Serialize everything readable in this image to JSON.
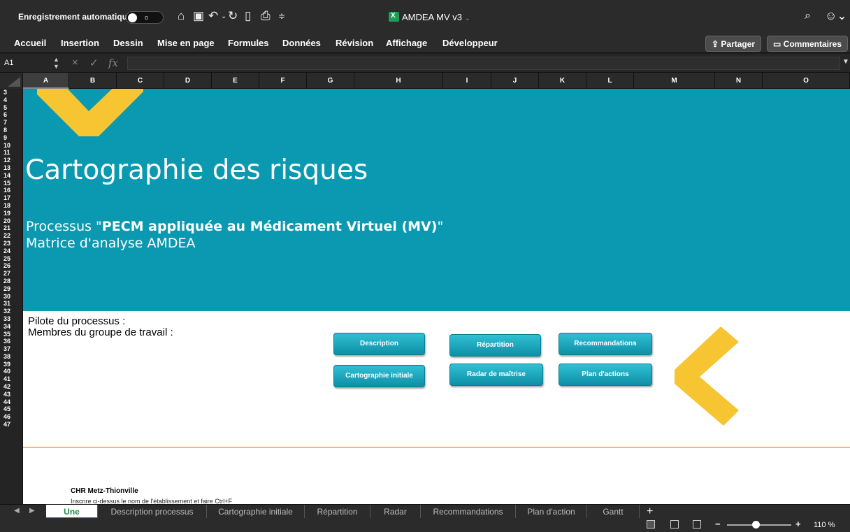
{
  "titlebar": {
    "autosave_label": "Enregistrement automatique",
    "autosave_state": "o",
    "doc_title": "AMDEA MV v3",
    "icons": [
      "home-icon",
      "save-icon",
      "undo-icon",
      "redo-icon",
      "new-doc-icon",
      "print-icon",
      "customize-icon",
      "search-icon",
      "emoji-icon"
    ]
  },
  "ribbon": {
    "tabs": [
      "Accueil",
      "Insertion",
      "Dessin",
      "Mise en page",
      "Formules",
      "Données",
      "Révision",
      "Affichage",
      "Développeur"
    ],
    "share_label": "Partager",
    "comments_label": "Commentaires"
  },
  "formula_bar": {
    "name_box": "A1",
    "fx_label": "fx",
    "value": ""
  },
  "columns": [
    "A",
    "B",
    "C",
    "D",
    "E",
    "F",
    "G",
    "H",
    "I",
    "J",
    "K",
    "L",
    "M",
    "N",
    "O"
  ],
  "rows": [
    "3",
    "4",
    "5",
    "6",
    "7",
    "8",
    "9",
    "10",
    "11",
    "12",
    "13",
    "14",
    "15",
    "16",
    "17",
    "18",
    "19",
    "20",
    "21",
    "22",
    "23",
    "24",
    "25",
    "26",
    "27",
    "28",
    "29",
    "30",
    "31",
    "32",
    "33",
    "34",
    "35",
    "36",
    "37",
    "38",
    "39",
    "40",
    "41",
    "42",
    "43",
    "44",
    "45",
    "46",
    "47"
  ],
  "sheet": {
    "title": "Cartographie des risques",
    "process_prefix": "Processus \"",
    "process_name": "PECM appliquée au Médicament Virtuel (MV)",
    "process_suffix": "\"",
    "matrix": "Matrice d'analyse AMDEA",
    "pilote": "Pilote du processus :",
    "members": "Membres du groupe de travail :",
    "buttons": {
      "description": "Description",
      "repartition": "Répartition",
      "recommandations": "Recommandations",
      "cartographie": "Cartographie initiale",
      "radar": "Radar de maîtrise",
      "plan": "Plan d'actions"
    },
    "org": "CHR Metz-Thionville",
    "hint": "Inscrire ci-dessus le nom de l'établissement et faire Ctrl+F"
  },
  "sheet_tabs": [
    "Une",
    "Description processus",
    "Cartographie initiale",
    "Répartition",
    "Radar",
    "Recommandations",
    "Plan d'action",
    "Gantt"
  ],
  "status": {
    "zoom": "110 %",
    "zoom_level": 0.45
  },
  "colors": {
    "banner": "#0a99b0",
    "accent_gold": "#f7c531",
    "button": "#1aa7bd"
  }
}
